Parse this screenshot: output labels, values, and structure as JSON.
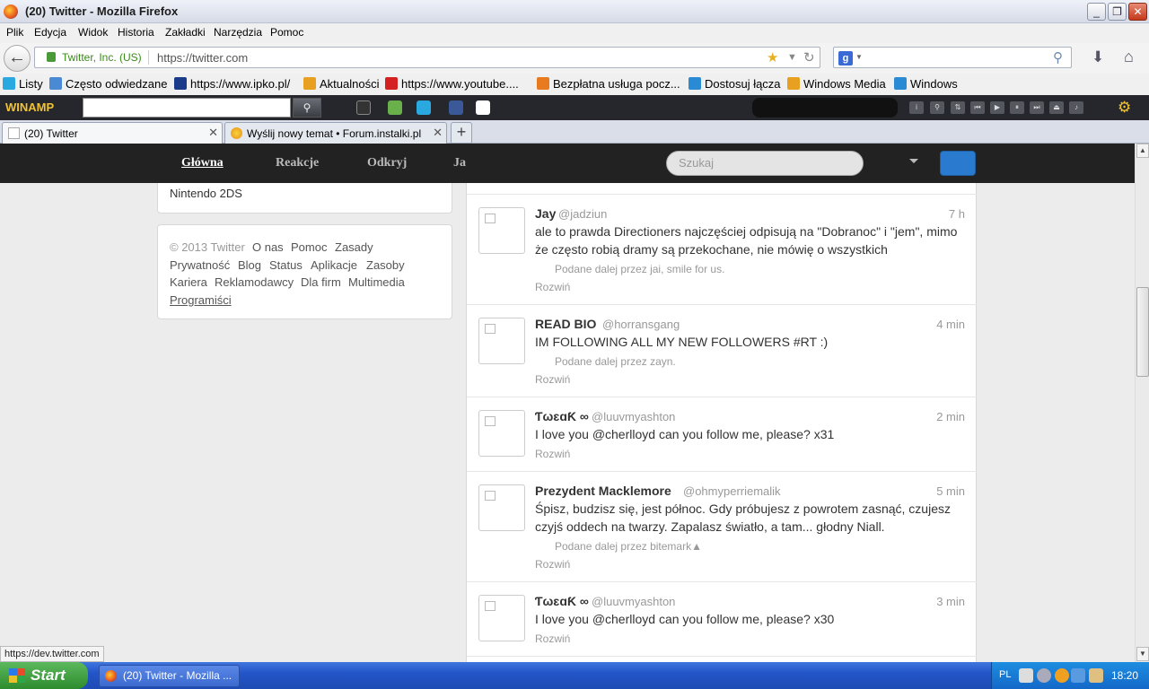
{
  "window": {
    "title": "(20) Twitter - Mozilla Firefox"
  },
  "menu": [
    "Plik",
    "Edycja",
    "Widok",
    "Historia",
    "Zakładki",
    "Narzędzia",
    "Pomoc"
  ],
  "nav": {
    "identity": "Twitter, Inc. (US)",
    "url": "https://twitter.com"
  },
  "bookmarks": [
    {
      "label": "Listy",
      "color": "#2aa9e0"
    },
    {
      "label": "Często odwiedzane",
      "color": "#4a8ad4"
    },
    {
      "label": "https://www.ipko.pl/",
      "color": "#1a3a8a"
    },
    {
      "label": "Aktualności",
      "color": "#e8a020"
    },
    {
      "label": "https://www.youtube....",
      "color": "#d42020"
    },
    {
      "label": "Bezpłatna usługa pocz...",
      "color": "#e87a20"
    },
    {
      "label": "Dostosuj łącza",
      "color": "#2a8ad4"
    },
    {
      "label": "Windows Media",
      "color": "#e8a020"
    },
    {
      "label": "Windows",
      "color": "#2a8ad4"
    }
  ],
  "winamp": {
    "logo": "WINAMP"
  },
  "tabs": [
    {
      "title": "(20) Twitter"
    },
    {
      "title": "Wyślij nowy temat • Forum.instalki.pl"
    }
  ],
  "twitter_nav": {
    "home": "Główna",
    "connect": "Reakcje",
    "discover": "Odkryj",
    "me": "Ja",
    "search_placeholder": "Szukaj"
  },
  "sidebar": {
    "trend_item": "Nintendo 2DS",
    "footer_links": [
      "© 2013 Twitter",
      "O nas",
      "Pomoc",
      "Zasady",
      "Prywatność",
      "Blog",
      "Status",
      "Aplikacje",
      "Zasoby",
      "Kariera",
      "Reklamodawcy",
      "Dla firm",
      "Multimedia",
      "Programiści"
    ]
  },
  "tweets": [
    {
      "name": "Jay",
      "handle": "@jadziun",
      "time": "7 h",
      "text": "ale to prawda Directioners najczęściej odpisują na \"Dobranoc\" i \"jem\", mimo że często robią dramy są przekochane, nie mówię o wszystkich",
      "retweeted_by": "Podane dalej przez jai, smile for us.",
      "expand": "Rozwiń"
    },
    {
      "name": "READ BIO",
      "handle": "@horransgang",
      "time": "4 min",
      "text": "IM FOLLOWING ALL MY NEW FOLLOWERS #RT :)",
      "retweeted_by": "Podane dalej przez zayn.",
      "expand": "Rozwiń"
    },
    {
      "name": "ƬωɛɑƘ ∞",
      "handle": "@luuvmyashton",
      "time": "2 min",
      "text": "I love you @cherlloyd can you follow me, please? x31",
      "retweeted_by": "",
      "expand": "Rozwiń"
    },
    {
      "name": "Prezydent Macklemore",
      "handle": "@ohmyperriemalik",
      "time": "5 min",
      "text": "Śpisz, budzisz się, jest północ. Gdy próbujesz z powrotem zasnąć, czujesz czyjś oddech na twarzy. Zapalasz światło, a tam... głodny Niall.",
      "retweeted_by": "Podane dalej przez bitemark▲",
      "expand": "Rozwiń"
    },
    {
      "name": "ƬωɛɑƘ ∞",
      "handle": "@luuvmyashton",
      "time": "3 min",
      "text": "I love you @cherlloyd can you follow me, please? x30",
      "retweeted_by": "",
      "expand": "Rozwiń"
    }
  ],
  "status_link": "https://dev.twitter.com",
  "taskbar": {
    "start": "Start",
    "item": "(20) Twitter - Mozilla ...",
    "lang": "PL",
    "clock": "18:20"
  }
}
